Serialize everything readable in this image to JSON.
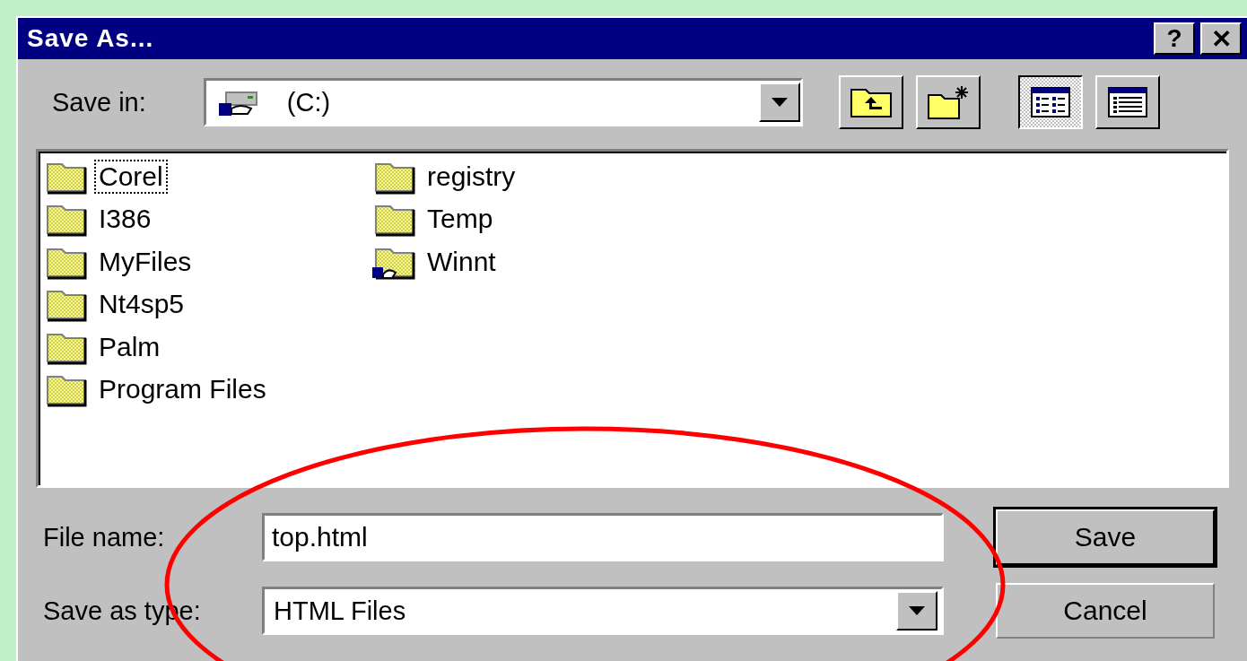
{
  "window": {
    "title": "Save As...",
    "help_button": "?",
    "close_button": "✕"
  },
  "save_in": {
    "label": "Save in:",
    "value": "(C:)"
  },
  "view_buttons": [
    {
      "kind": "list",
      "selected": true
    },
    {
      "kind": "details",
      "selected": false
    }
  ],
  "files": [
    {
      "name": "Corel",
      "focused": true,
      "shared": false
    },
    {
      "name": "I386",
      "focused": false,
      "shared": false
    },
    {
      "name": "MyFiles",
      "focused": false,
      "shared": false
    },
    {
      "name": "Nt4sp5",
      "focused": false,
      "shared": false
    },
    {
      "name": "Palm",
      "focused": false,
      "shared": false
    },
    {
      "name": "Program Files",
      "focused": false,
      "shared": false
    },
    {
      "name": "registry",
      "focused": false,
      "shared": false
    },
    {
      "name": "Temp",
      "focused": false,
      "shared": false
    },
    {
      "name": "Winnt",
      "focused": false,
      "shared": true
    }
  ],
  "file_name": {
    "label": "File name:",
    "value": "top.html"
  },
  "save_as_type": {
    "label": "Save as type:",
    "value": "HTML Files"
  },
  "buttons": [
    {
      "label": "Save",
      "default": true
    },
    {
      "label": "Cancel",
      "default": false
    }
  ]
}
